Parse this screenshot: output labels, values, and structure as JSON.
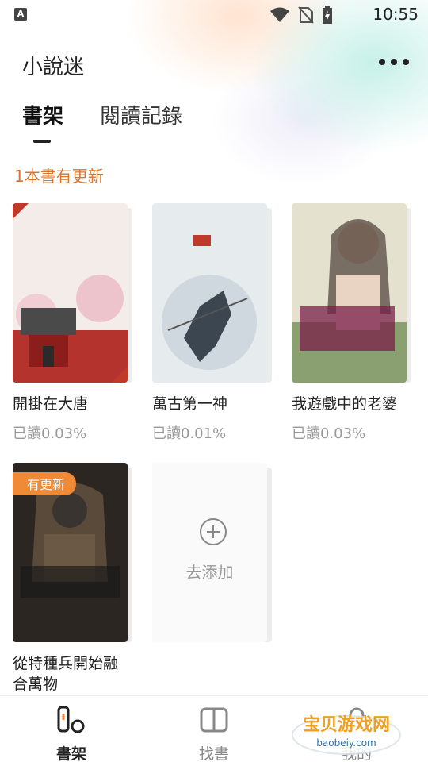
{
  "status_bar": {
    "time": "10:55",
    "app_icon_letter": "A"
  },
  "header": {
    "title": "小說迷",
    "more_icon": "more-dots-icon"
  },
  "tabs": [
    {
      "label": "書架",
      "active": true
    },
    {
      "label": "閱讀記錄",
      "active": false
    }
  ],
  "update_notice": "1本書有更新",
  "books": [
    {
      "title": "開掛在大唐",
      "progress": "已讀0.03%",
      "badge": ""
    },
    {
      "title": "萬古第一神",
      "progress": "已讀0.01%",
      "badge": ""
    },
    {
      "title": "我遊戲中的老婆",
      "progress": "已讀0.03%",
      "badge": ""
    },
    {
      "title": "從特種兵開始融合萬物",
      "progress": "",
      "badge": "有更新"
    }
  ],
  "add_card": {
    "label": "去添加",
    "icon": "plus-circle-icon"
  },
  "bottom_nav": [
    {
      "label": "書架",
      "icon": "bookshelf-icon",
      "active": true
    },
    {
      "label": "找書",
      "icon": "find-book-icon",
      "active": false
    },
    {
      "label": "我的",
      "icon": "profile-icon",
      "active": false
    }
  ],
  "watermark": {
    "title": "宝贝游戏网",
    "url": "baobeiy.com"
  },
  "colors": {
    "accent": "#f08a37",
    "update_text": "#d9742a"
  }
}
